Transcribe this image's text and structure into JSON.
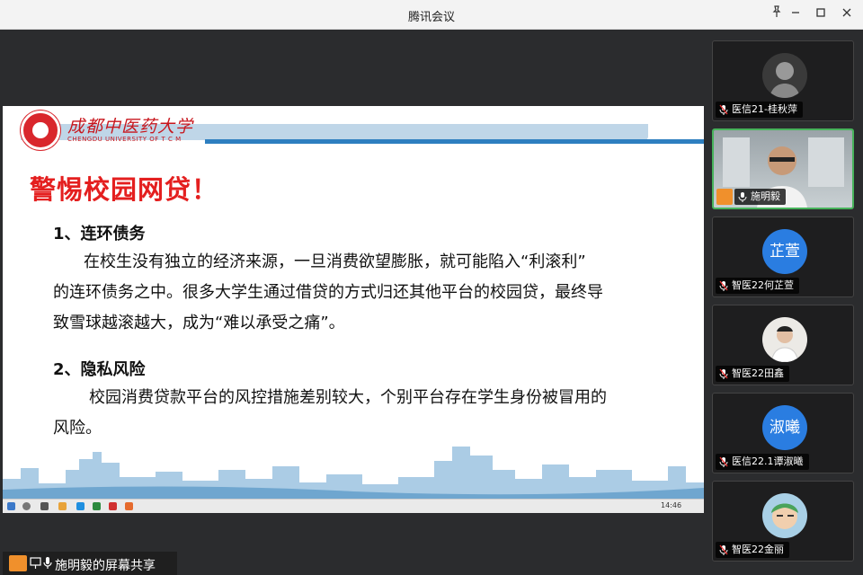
{
  "window": {
    "title": "腾讯会议"
  },
  "slide": {
    "logo_cn": "成都中医药大学",
    "logo_en": "CHENGDU UNIVERSITY OF T C M",
    "title": "警惕校园网贷！",
    "section1_heading": "1、连环债务",
    "section1_line1": "在校生没有独立的经济来源，一旦消费欲望膨胀，就可能陷入“利滚利”",
    "section1_line2": "的连环债务之中。很多大学生通过借贷的方式归还其他平台的校园贷，最终导",
    "section1_line3": "致雪球越滚越大，成为“难以承受之痛”。",
    "section2_heading": "2、隐私风险",
    "section2_line1": "校园消费贷款平台的风控措施差别较大，个别平台存在学生身份被冒用的",
    "section2_line2": "风险。",
    "taskbar_time": "14:46"
  },
  "share_bar": {
    "label": "施明毅的屏幕共享"
  },
  "participants": [
    {
      "name": "医信21-桂秋萍",
      "avatar": "photo-man"
    },
    {
      "name": "施明毅",
      "avatar": "video"
    },
    {
      "name": "智医22何芷萱",
      "avatar_text": "芷萱"
    },
    {
      "name": "智医22田鑫",
      "avatar": "photo-boy"
    },
    {
      "name": "医信22.1谭淑曦",
      "avatar_text": "淑曦"
    },
    {
      "name": "智医22金丽",
      "avatar": "anime"
    }
  ],
  "colors": {
    "accent_red": "#e41f1f",
    "brand_blue": "#2e7fc0",
    "active_border": "#47b35b",
    "avatar_blue": "#2a7de1"
  }
}
